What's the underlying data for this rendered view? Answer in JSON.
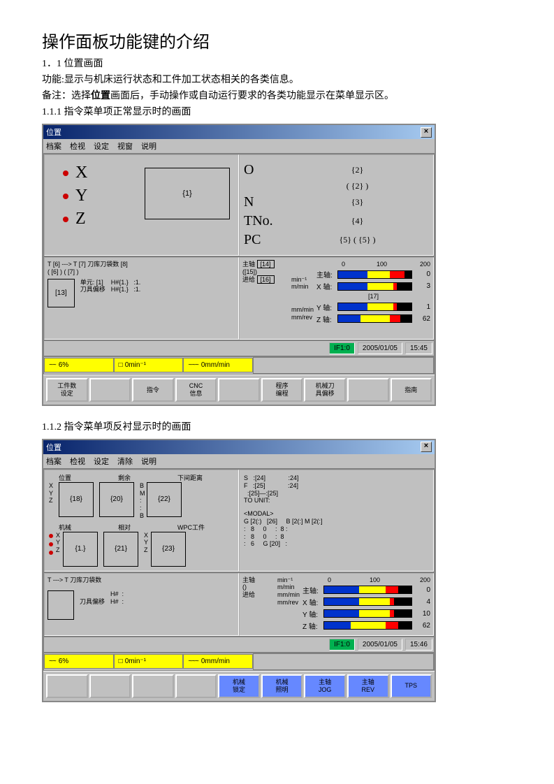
{
  "doc": {
    "title": "操作面板功能键的介绍",
    "s1_heading": "1．1 位置画面",
    "s1_line1": "功能:显示与机床运行状态和工件加工状态相关的各类信息。",
    "s1_line2a": "备注：选择",
    "s1_line2b": "位置",
    "s1_line2c": "画面后，手动操作或自动运行要求的各类功能显示在菜单显示区。",
    "s111": "1.1.1 指令菜单项正常显示时的画面",
    "s112": "1.1.2 指令菜单项反衬显示时的画面"
  },
  "screen1": {
    "title": "位置",
    "menu": [
      "档案",
      "检视",
      "设定",
      "视窗",
      "说明"
    ],
    "axes": [
      "X",
      "Y",
      "Z"
    ],
    "center_box": "{1}",
    "right_rows": [
      {
        "lbl": "O",
        "val": "{2}"
      },
      {
        "lbl": "",
        "val": "(               {2}               )"
      },
      {
        "lbl": "N",
        "val": "{3}"
      },
      {
        "lbl": "TNo.",
        "val": "{4}"
      },
      {
        "lbl": "PC",
        "val": "{5}      (     {5}     )"
      }
    ],
    "lowerleft_line1": "T  [6]  --->  T  [7]          刀库刀袋数  [8]",
    "lowerleft_line2": "(   [6]   )         (  [7]  )",
    "lowerleft_unit": "单元: [1]",
    "lowerleft_tool": "刀具偏移",
    "lowerleft_box": "[13]",
    "lowerleft_hv": "H#{1.}   :1.\nH#{1.}   :1.",
    "spindle_label": "主轴",
    "spindle_sub": "([15])",
    "feed_label": "进给",
    "spindle_box1": "[14]",
    "spindle_box2": "[16]",
    "units1": "min⁻¹\nm/min",
    "units2": "mm/min\nmm/rev",
    "bar_scale": [
      "0",
      "100",
      "200"
    ],
    "bars": [
      {
        "label": "主轴:",
        "b": 40,
        "y": 30,
        "r": 20,
        "v": "0"
      },
      {
        "label": "X 轴:",
        "b": 40,
        "y": 35,
        "r": 5,
        "v": "3"
      },
      {
        "label": "Y 轴:",
        "b": 40,
        "y": 35,
        "r": 5,
        "v": "1"
      },
      {
        "label": "Z 轴:",
        "b": 30,
        "y": 40,
        "r": 15,
        "v": "62"
      }
    ],
    "bar_anno": "[17]",
    "status": {
      "green": "IF1:0",
      "date": "2005/01/05",
      "time": "15:45"
    },
    "yellow": [
      {
        "icon": "~~",
        "val": "6%"
      },
      {
        "icon": "□",
        "val": "0min⁻¹"
      },
      {
        "icon": "~~~",
        "val": "0mm/min"
      }
    ],
    "buttons": [
      "工件数\n设定",
      "",
      "指令",
      "CNC\n信息",
      "",
      "程序\n编程",
      "机械刀\n具偏移",
      "",
      "指南"
    ]
  },
  "screen2": {
    "title": "位置",
    "menu": [
      "档案",
      "检视",
      "设定",
      "清除",
      "说明"
    ],
    "panel_headers": [
      "位置",
      "剩余",
      "下间距离"
    ],
    "panel_axes": "X\nY\nZ",
    "boxes_top": [
      "{18}",
      "{20}",
      "{22}"
    ],
    "mid_axes": "B\nM\n:\n:\nB",
    "panel_headers2": [
      "机械",
      "相对",
      "WPC工件"
    ],
    "panel_axes2": "X\nY\nZ",
    "boxes_bot": [
      "{1.}",
      "{21}",
      "{23}"
    ],
    "mid_ax2": "X\nY\nZ",
    "right_top": "S   :[24]             :24]\nF   :[25]             :24]\n  :[25]—:[25]\nTO UNIT:",
    "right_modal_title": "<MODAL>",
    "right_modal": "G [2(:)   [26]     B [2(:] M [2(:]\n:   8     0     :  8 :\n:   8     0     :  8\n:   6     G [20]   :",
    "lowerleft_line": "T         --->  T            刀库刀袋数",
    "lowerleft_tool": "刀具偏移",
    "lowerleft_hv": "H#  :\nH#  :",
    "spindle_label": "主轴",
    "spindle_sub": "()",
    "feed_label": "进给",
    "units1": "min⁻¹\nm/min",
    "units2": "mm/min\nmm/rev",
    "bar_scale": [
      "0",
      "100",
      "200"
    ],
    "bars": [
      {
        "label": "主轴:",
        "b": 40,
        "y": 30,
        "r": 15,
        "v": "0"
      },
      {
        "label": "X 轴:",
        "b": 40,
        "y": 35,
        "r": 5,
        "v": "4"
      },
      {
        "label": "Y 轴:",
        "b": 40,
        "y": 35,
        "r": 5,
        "v": "10"
      },
      {
        "label": "Z 轴:",
        "b": 30,
        "y": 40,
        "r": 15,
        "v": "62"
      }
    ],
    "status": {
      "green": "IF1:0",
      "date": "2005/01/05",
      "time": "15:46"
    },
    "yellow": [
      {
        "icon": "~~",
        "val": "6%"
      },
      {
        "icon": "□",
        "val": "0min⁻¹"
      },
      {
        "icon": "~~~",
        "val": "0mm/min"
      }
    ],
    "buttons": [
      "",
      "",
      "",
      "",
      "机械\n锁定",
      "机械\n照明",
      "主轴\nJOG",
      "主轴\nREV",
      "TPS"
    ]
  }
}
